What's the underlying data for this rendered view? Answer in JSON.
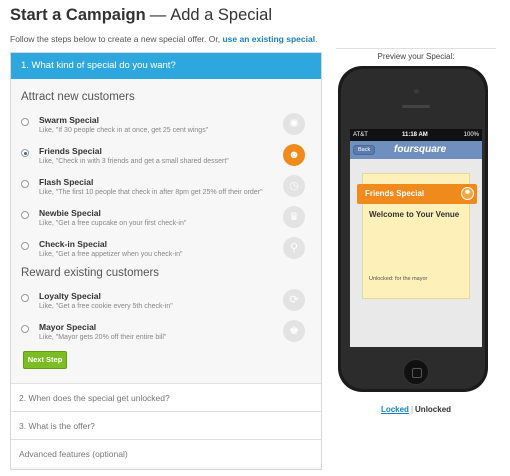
{
  "header": {
    "title_bold": "Start a Campaign",
    "title_dash": "—",
    "title_rest": "Add a Special",
    "subtitle": "Follow the steps below to create a new special offer. Or,",
    "subtitle_link": "use an existing special",
    "subtitle_end": "."
  },
  "wizard": {
    "step1_title": "1. What kind of special do you want?",
    "group1_title": "Attract new customers",
    "group2_title": "Reward existing customers",
    "options": [
      {
        "name": "Swarm Special",
        "desc": "Like, \"If 30 people check in at once, get 25 cent wings\"",
        "selected": false,
        "icon": "swarm-badge-icon"
      },
      {
        "name": "Friends Special",
        "desc": "Like, \"Check in with 3 friends and get a small shared dessert\"",
        "selected": true,
        "icon": "friends-badge-icon"
      },
      {
        "name": "Flash Special",
        "desc": "Like, \"The first 10 people that check in after 8pm get 25% off their order\"",
        "selected": false,
        "icon": "flash-badge-icon"
      },
      {
        "name": "Newbie Special",
        "desc": "Like, \"Get a free cupcake on your first check-in\"",
        "selected": false,
        "icon": "newbie-badge-icon"
      },
      {
        "name": "Check-in Special",
        "desc": "Like, \"Get a free appetizer when you check-in\"",
        "selected": false,
        "icon": "checkin-badge-icon"
      },
      {
        "name": "Loyalty Special",
        "desc": "Like, \"Get a free cookie every 5th check-in\"",
        "selected": false,
        "icon": "loyalty-badge-icon"
      },
      {
        "name": "Mayor Special",
        "desc": "Like, \"Mayor gets 20% off their entire bill\"",
        "selected": false,
        "icon": "mayor-badge-icon"
      }
    ],
    "next_label": "Next Step",
    "step2_title": "2. When does the special get unlocked?",
    "step3_title": "3. What is the offer?",
    "step4_title": "Advanced features (optional)"
  },
  "preview": {
    "label": "Preview your Special:",
    "status_carrier": "AT&T",
    "status_time": "11:18 AM",
    "status_battery": "100%",
    "back_label": "Back",
    "brand": "foursquare",
    "special_name": "Friends Special",
    "welcome": "Welcome to Your Venue",
    "unlocked_text": "Unlocked: for the mayor",
    "toggle_locked": "Locked",
    "toggle_sep": "|",
    "toggle_unlocked": "Unlocked"
  },
  "colors": {
    "accent_blue": "#2ea7de",
    "selected_orange": "#f08a1c",
    "next_green": "#7dbd24",
    "link_blue": "#1a7fc1"
  }
}
